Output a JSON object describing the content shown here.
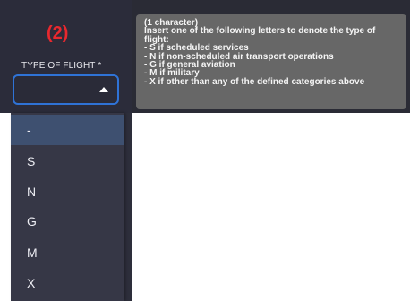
{
  "annotation": {
    "label": "(2)",
    "color": "#e8282e"
  },
  "field": {
    "label": "TYPE OF FLIGHT *",
    "value": "",
    "accent": "#2f73d6"
  },
  "tooltip": {
    "lines": [
      "(1 character)",
      "Insert one of the following letters to denote the type of",
      "flight:",
      "- S if scheduled services",
      "- N if non-scheduled air transport operations",
      "- G if general aviation",
      "- M if military",
      "- X if other than any of the defined categories above"
    ]
  },
  "dropdown": {
    "options": [
      "-",
      "S",
      "N",
      "G",
      "M",
      "X"
    ],
    "highlighted": "-"
  },
  "icons": {
    "caret": "caret-up-icon"
  }
}
